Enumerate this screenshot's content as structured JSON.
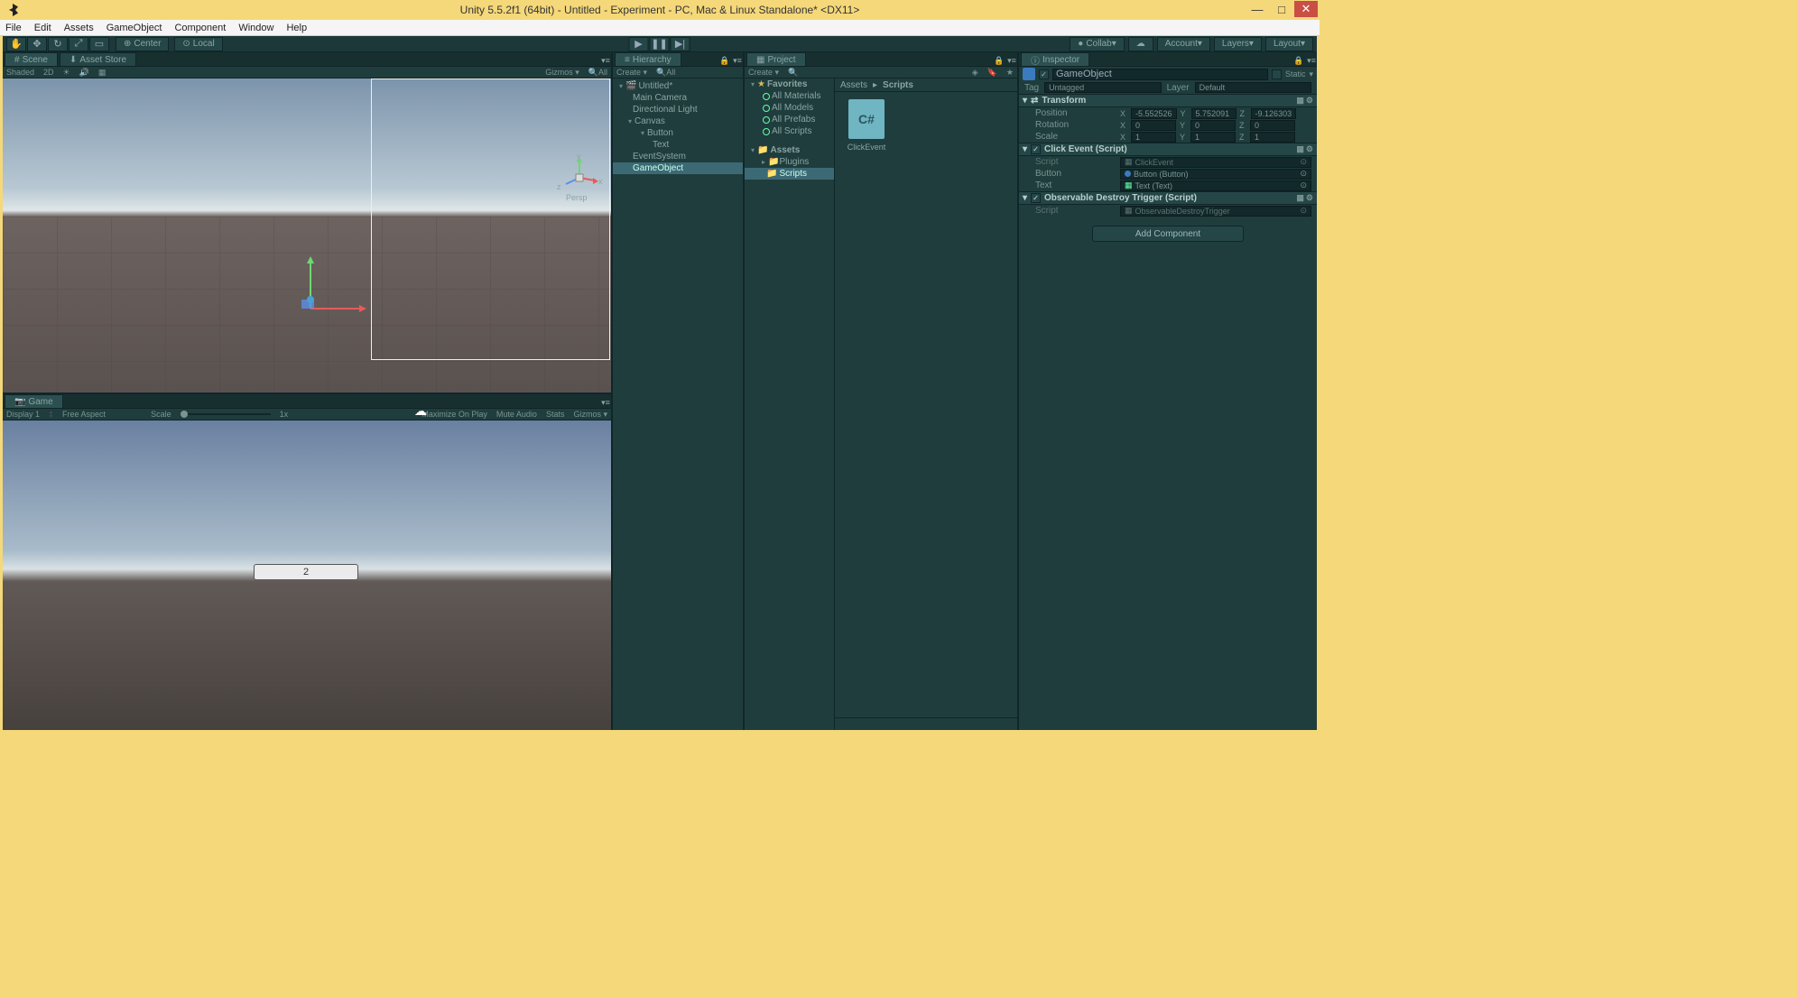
{
  "window": {
    "title": "Unity 5.5.2f1 (64bit) - Untitled - Experiment - PC, Mac & Linux Standalone* <DX11>"
  },
  "menubar": [
    "File",
    "Edit",
    "Assets",
    "GameObject",
    "Component",
    "Window",
    "Help"
  ],
  "toolbar": {
    "center": "Center",
    "local": "Local",
    "collab": "Collab",
    "account": "Account",
    "layers": "Layers",
    "layout": "Layout"
  },
  "scene_tab": "Scene",
  "asset_store_tab": "Asset Store",
  "scene_sub": {
    "shaded": "Shaded",
    "twod": "2D",
    "gizmos": "Gizmos",
    "search": "All"
  },
  "scene_overlay": {
    "persp": "Persp",
    "y": "y",
    "x": "x",
    "z": "z"
  },
  "game_tab": "Game",
  "game_sub": {
    "display": "Display 1",
    "aspect": "Free Aspect",
    "scale": "Scale",
    "scaleval": "1x",
    "maximize": "Maximize On Play",
    "mute": "Mute Audio",
    "stats": "Stats",
    "gizmos": "Gizmos"
  },
  "game_button_text": "2",
  "hierarchy": {
    "tab": "Hierarchy",
    "create": "Create",
    "search": "All",
    "root": "Untitled*",
    "items": [
      "Main Camera",
      "Directional Light",
      "Canvas",
      "Button",
      "Text",
      "EventSystem",
      "GameObject"
    ]
  },
  "project": {
    "tab": "Project",
    "create": "Create",
    "favorites": "Favorites",
    "fav_items": [
      "All Materials",
      "All Models",
      "All Prefabs",
      "All Scripts"
    ],
    "assets": "Assets",
    "folders": [
      "Plugins",
      "Scripts"
    ],
    "breadcrumb": [
      "Assets",
      "Scripts"
    ],
    "asset_name": "ClickEvent",
    "asset_badge": "C#"
  },
  "inspector": {
    "tab": "Inspector",
    "name": "GameObject",
    "static": "Static",
    "tag_label": "Tag",
    "tag_value": "Untagged",
    "layer_label": "Layer",
    "layer_value": "Default",
    "transform": "Transform",
    "position": "Position",
    "rotation": "Rotation",
    "scale": "Scale",
    "pos": {
      "x": "-5.552526",
      "y": "5.752091",
      "z": "-9.126303"
    },
    "rot": {
      "x": "0",
      "y": "0",
      "z": "0"
    },
    "scl": {
      "x": "1",
      "y": "1",
      "z": "1"
    },
    "click_event": "Click Event (Script)",
    "script_label": "Script",
    "script_value": "ClickEvent",
    "button_label": "Button",
    "button_value": "Button (Button)",
    "text_label": "Text",
    "text_value": "Text (Text)",
    "obs_destroy": "Observable Destroy Trigger (Script)",
    "obs_script_value": "ObservableDestroyTrigger",
    "add_component": "Add Component"
  }
}
